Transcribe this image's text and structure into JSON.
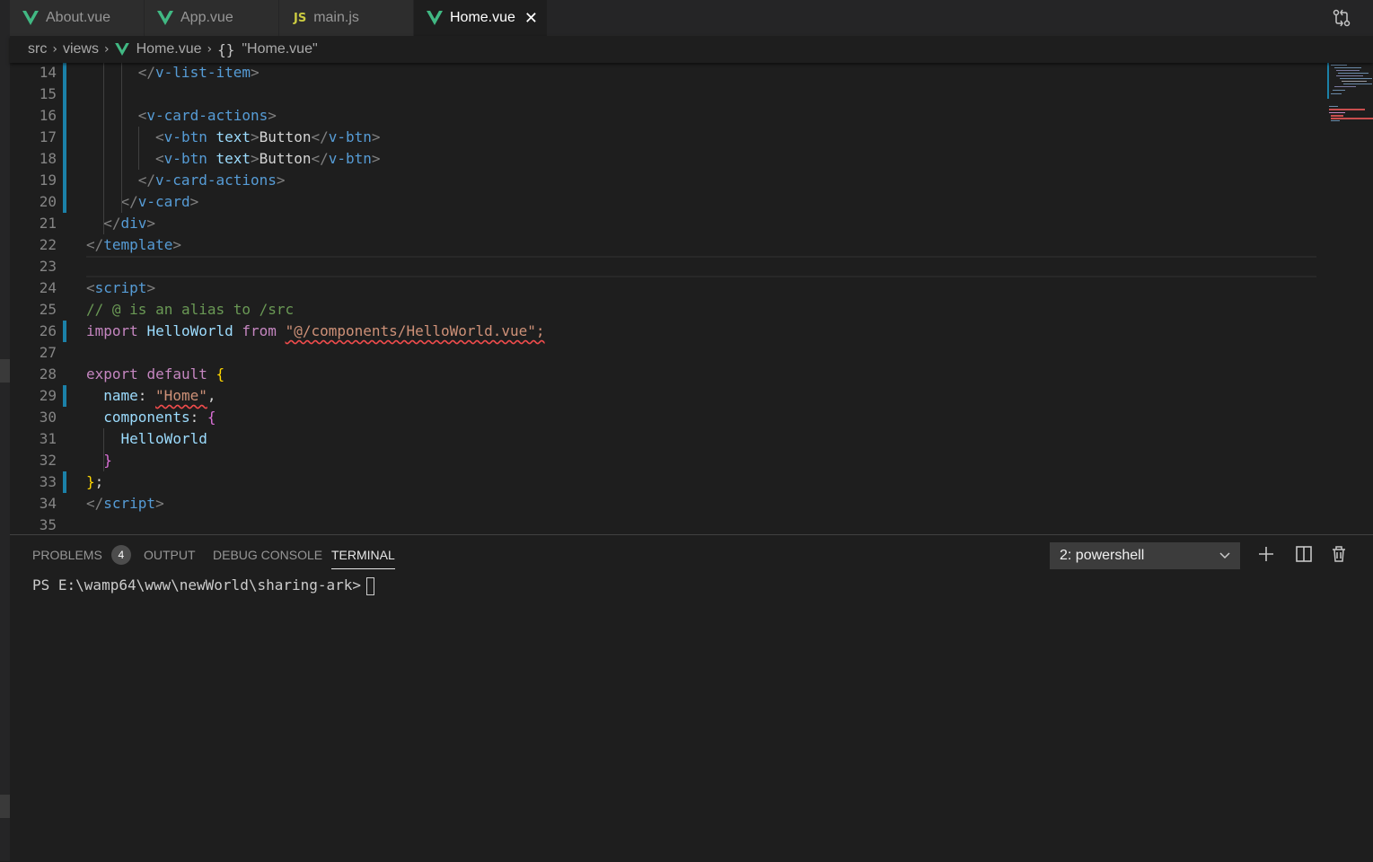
{
  "tabs": [
    {
      "label": "About.vue",
      "icon": "vue-icon",
      "active": false
    },
    {
      "label": "App.vue",
      "icon": "vue-icon",
      "active": false
    },
    {
      "label": "main.js",
      "icon": "js-icon",
      "active": false
    },
    {
      "label": "Home.vue",
      "icon": "vue-icon",
      "active": true
    }
  ],
  "js_icon_text": "JS",
  "close_glyph": "✕",
  "breadcrumb": {
    "items": [
      "src",
      "views",
      "Home.vue",
      "\"Home.vue\""
    ],
    "separator": "›",
    "braces": "{}"
  },
  "editor": {
    "line_numbers": [
      "14",
      "15",
      "16",
      "17",
      "18",
      "19",
      "20",
      "21",
      "22",
      "23",
      "24",
      "25",
      "26",
      "27",
      "28",
      "29",
      "30",
      "31",
      "32",
      "33",
      "34",
      "35"
    ],
    "lines": [
      [
        {
          "t": "</",
          "c": "tg"
        },
        {
          "t": "v-list-item",
          "c": "tn"
        },
        {
          "t": ">",
          "c": "tg"
        }
      ],
      [],
      [
        {
          "t": "<",
          "c": "tg"
        },
        {
          "t": "v-card-actions",
          "c": "tn"
        },
        {
          "t": ">",
          "c": "tg"
        }
      ],
      [
        {
          "t": "<",
          "c": "tg"
        },
        {
          "t": "v-btn",
          "c": "tn"
        },
        {
          "t": " ",
          "c": "tx"
        },
        {
          "t": "text",
          "c": "at"
        },
        {
          "t": ">",
          "c": "tg"
        },
        {
          "t": "Button",
          "c": "tx"
        },
        {
          "t": "</",
          "c": "tg"
        },
        {
          "t": "v-btn",
          "c": "tn"
        },
        {
          "t": ">",
          "c": "tg"
        }
      ],
      [
        {
          "t": "<",
          "c": "tg"
        },
        {
          "t": "v-btn",
          "c": "tn"
        },
        {
          "t": " ",
          "c": "tx"
        },
        {
          "t": "text",
          "c": "at"
        },
        {
          "t": ">",
          "c": "tg"
        },
        {
          "t": "Button",
          "c": "tx"
        },
        {
          "t": "</",
          "c": "tg"
        },
        {
          "t": "v-btn",
          "c": "tn"
        },
        {
          "t": ">",
          "c": "tg"
        }
      ],
      [
        {
          "t": "</",
          "c": "tg"
        },
        {
          "t": "v-card-actions",
          "c": "tn"
        },
        {
          "t": ">",
          "c": "tg"
        }
      ],
      [
        {
          "t": "</",
          "c": "tg"
        },
        {
          "t": "v-card",
          "c": "tn"
        },
        {
          "t": ">",
          "c": "tg"
        }
      ],
      [
        {
          "t": "</",
          "c": "tg"
        },
        {
          "t": "div",
          "c": "tn"
        },
        {
          "t": ">",
          "c": "tg"
        }
      ],
      [
        {
          "t": "</",
          "c": "tg"
        },
        {
          "t": "template",
          "c": "tn"
        },
        {
          "t": ">",
          "c": "tg"
        }
      ],
      [],
      [
        {
          "t": "<",
          "c": "tg"
        },
        {
          "t": "script",
          "c": "tn"
        },
        {
          "t": ">",
          "c": "tg"
        }
      ],
      [
        {
          "t": "// @ is an alias to /src",
          "c": "cm"
        }
      ],
      [
        {
          "t": "import",
          "c": "kw"
        },
        {
          "t": " ",
          "c": "tx"
        },
        {
          "t": "HelloWorld",
          "c": "vr"
        },
        {
          "t": " ",
          "c": "tx"
        },
        {
          "t": "from",
          "c": "kw"
        },
        {
          "t": " ",
          "c": "tx"
        },
        {
          "t": "\"@/components/HelloWorld.vue\";",
          "c": "st squig"
        }
      ],
      [],
      [
        {
          "t": "export",
          "c": "kw"
        },
        {
          "t": " ",
          "c": "tx"
        },
        {
          "t": "default",
          "c": "kw"
        },
        {
          "t": " ",
          "c": "tx"
        },
        {
          "t": "{",
          "c": "b1"
        }
      ],
      [
        {
          "t": "name",
          "c": "vr"
        },
        {
          "t": ": ",
          "c": "pn"
        },
        {
          "t": "\"Home\"",
          "c": "st squig"
        },
        {
          "t": ",",
          "c": "pn"
        }
      ],
      [
        {
          "t": "components",
          "c": "vr"
        },
        {
          "t": ": ",
          "c": "pn"
        },
        {
          "t": "{",
          "c": "b2"
        }
      ],
      [
        {
          "t": "HelloWorld",
          "c": "vr"
        }
      ],
      [
        {
          "t": "}",
          "c": "b2"
        }
      ],
      [
        {
          "t": "}",
          "c": "b1"
        },
        {
          "t": ";",
          "c": "pn"
        }
      ],
      [
        {
          "t": "</",
          "c": "tg"
        },
        {
          "t": "script",
          "c": "tn"
        },
        {
          "t": ">",
          "c": "tg"
        }
      ],
      []
    ],
    "modified_lines": [
      "14",
      "15",
      "16",
      "17",
      "18",
      "19",
      "20",
      "26",
      "29",
      "33"
    ]
  },
  "panel": {
    "tabs": [
      {
        "label": "PROBLEMS",
        "badge": "4",
        "active": false
      },
      {
        "label": "OUTPUT",
        "active": false
      },
      {
        "label": "DEBUG CONSOLE",
        "active": false
      },
      {
        "label": "TERMINAL",
        "active": true
      }
    ],
    "terminal_select": "2: powershell",
    "icons": [
      "plus-icon",
      "split-icon",
      "trash-icon"
    ],
    "terminal_prompt": "PS E:\\wamp64\\www\\newWorld\\sharing-ark>"
  },
  "colors": {
    "vue_green": "#41b883",
    "modified_gutter": "#1b81a8",
    "js_yellow": "#cbcb41"
  }
}
